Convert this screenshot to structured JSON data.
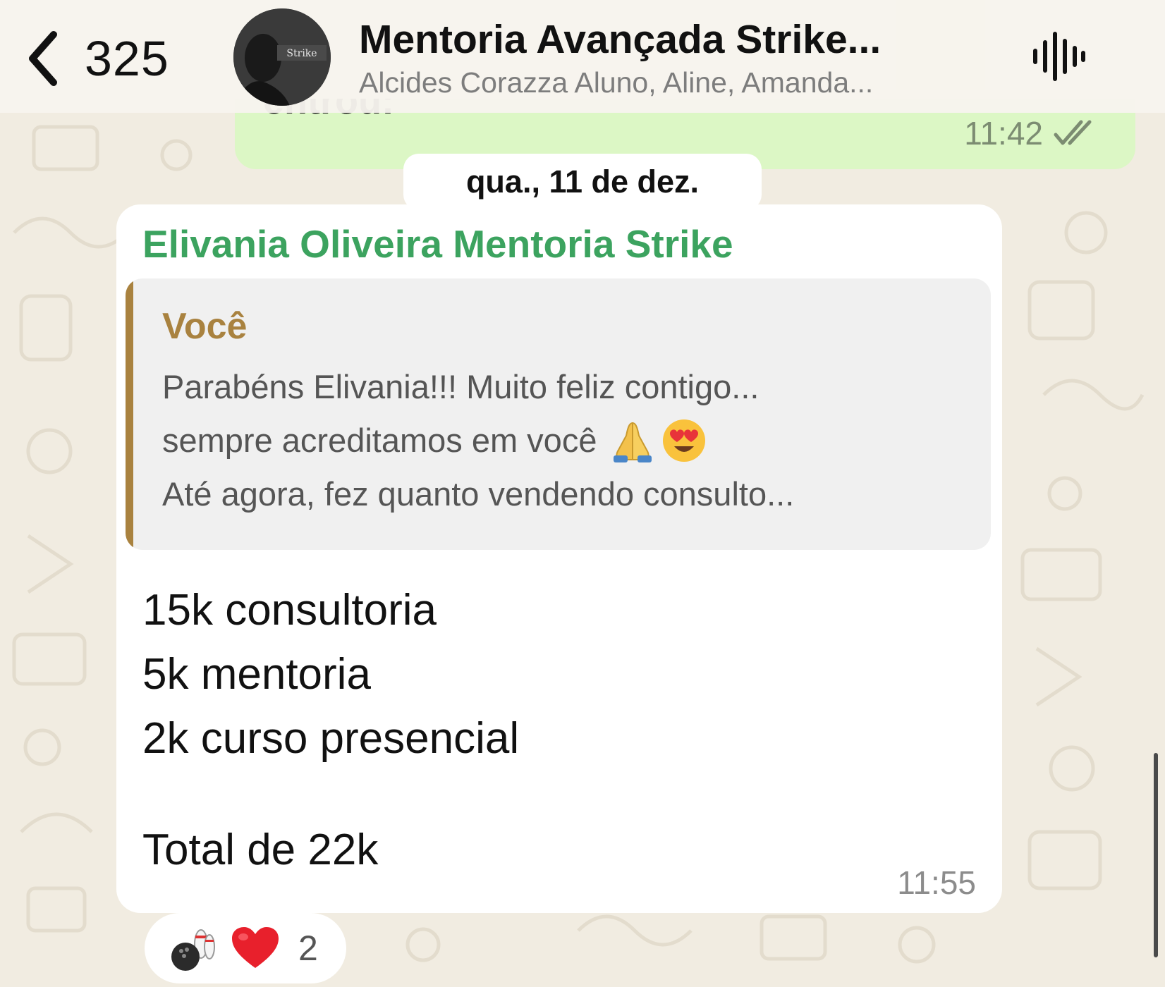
{
  "header": {
    "back_count": "325",
    "title": "Mentoria Avançada Strike...",
    "subtitle": "Alcides Corazza Aluno, Aline, Amanda...",
    "avatar_text": "Strike",
    "back_icon": "chevron-left-icon",
    "audio_icon": "audio-waveform-icon"
  },
  "previous_message": {
    "partial_text": "entrou:",
    "time": "11:42",
    "status_icon": "double-check-icon"
  },
  "date_separator": "qua., 11 de dez.",
  "message": {
    "sender": "Elivania Oliveira Mentoria Strike",
    "quote": {
      "author": "Você",
      "line1": "Parabéns Elivania!!! Muito feliz contigo...",
      "line2": "sempre acreditamos em você",
      "line2_emojis": [
        "folded-hands-emoji",
        "heart-eyes-emoji"
      ],
      "line3": "Até agora, fez quanto vendendo consulto..."
    },
    "lines": [
      "15k consultoria",
      "5k mentoria",
      "2k curso presencial"
    ],
    "total": "Total de 22k",
    "time": "11:55"
  },
  "reactions": {
    "emojis": [
      "bowling-icon",
      "red-heart-emoji"
    ],
    "count": "2"
  },
  "colors": {
    "background": "#f1ece1",
    "outgoing_bubble": "#dcf7c5",
    "incoming_bubble": "#ffffff",
    "sender_name": "#3ca35f",
    "quote_accent": "#a9823f",
    "quote_background": "#f0f0f0"
  }
}
